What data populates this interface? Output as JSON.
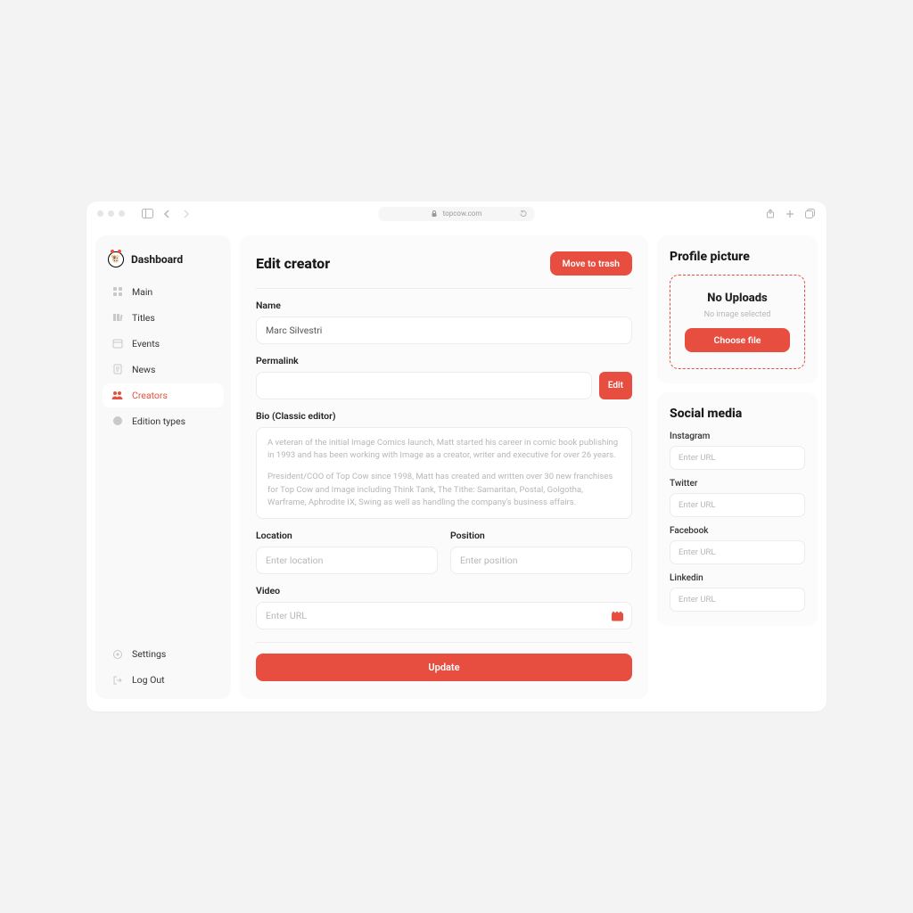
{
  "browser": {
    "url": "topcow.com"
  },
  "sidebar": {
    "brand": "Dashboard",
    "items": [
      {
        "label": "Main"
      },
      {
        "label": "Titles"
      },
      {
        "label": "Events"
      },
      {
        "label": "News"
      },
      {
        "label": "Creators"
      },
      {
        "label": "Edition types"
      }
    ],
    "bottom": [
      {
        "label": "Settings"
      },
      {
        "label": "Log Out"
      }
    ]
  },
  "main": {
    "title": "Edit creator",
    "trash_label": "Move to trash",
    "name_label": "Name",
    "name_value": "Marc Silvestri",
    "permalink_label": "Permalink",
    "permalink_value": "",
    "edit_label": "Edit",
    "bio_label": "Bio (Classic editor)",
    "bio_p1": "A veteran of the initial Image Comics launch, Matt started his career in comic book publishing in 1993 and has been working with Image as a creator, writer and executive for over 26 years.",
    "bio_p2": "President/COO of Top Cow since 1998, Matt has created and written over 30 new franchises for Top Cow and Image including Think Tank, The Tithe: Samaritan, Postal, Golgotha, Warframe, Aphrodite IX, Swing as well as handling the company's business affairs.",
    "location_label": "Location",
    "location_placeholder": "Enter location",
    "position_label": "Position",
    "position_placeholder": "Enter position",
    "video_label": "Video",
    "video_placeholder": "Enter URL",
    "update_label": "Update"
  },
  "profile": {
    "title": "Profile picture",
    "no_uploads": "No Uploads",
    "no_image": "No image selected",
    "choose_file": "Choose file"
  },
  "social": {
    "title": "Social media",
    "items": [
      {
        "label": "Instagram",
        "placeholder": "Enter URL"
      },
      {
        "label": "Twitter",
        "placeholder": "Enter URL"
      },
      {
        "label": "Facebook",
        "placeholder": "Enter URL"
      },
      {
        "label": "Linkedin",
        "placeholder": "Enter URL"
      }
    ]
  },
  "colors": {
    "accent": "#e74e40"
  }
}
